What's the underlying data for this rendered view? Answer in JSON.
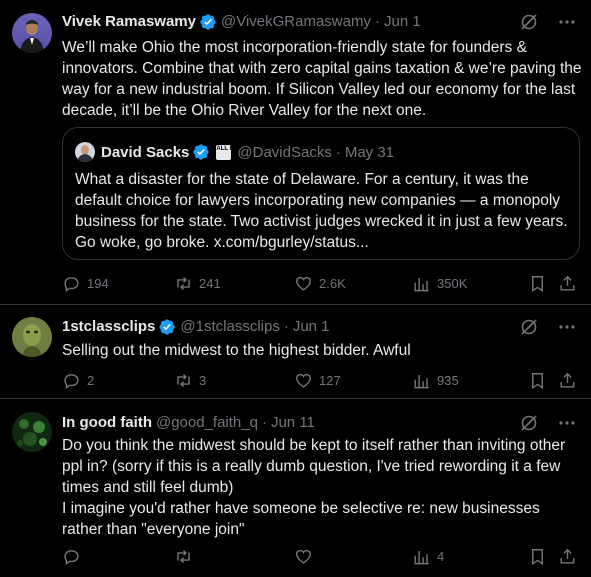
{
  "tweets": [
    {
      "name": "Vivek Ramaswamy",
      "handle": "@VivekGRamaswamy",
      "dot": "·",
      "date": "Jun 1",
      "text": "We’ll make Ohio the most incorporation-friendly state for founders & innovators. Combine that with zero capital gains taxation & we’re paving the way for a new industrial boom. If Silicon Valley led our economy for the last decade, it’ll be the Ohio River Valley for the next one.",
      "quote": {
        "name": "David Sacks",
        "badge": "ALL IN",
        "handle": "@DavidSacks",
        "dot": "·",
        "date": "May 31",
        "text": "What a disaster for the state of Delaware. For a century, it was the default choice for lawyers incorporating new companies — a monopoly business for the state. Two activist judges wrecked it in just a few years. Go woke, go broke. x.com/bgurley/status..."
      },
      "replies": "194",
      "reposts": "241",
      "likes": "2.6K",
      "views": "350K"
    },
    {
      "name": "1stclassclips",
      "handle": "@1stclassclips",
      "dot": "·",
      "date": "Jun 1",
      "text": "Selling out the midwest to the highest bidder. Awful",
      "replies": "2",
      "reposts": "3",
      "likes": "127",
      "views": "935"
    },
    {
      "name": "In good faith",
      "handle": "@good_faith_q",
      "dot": "·",
      "date": "Jun 11",
      "text_line1": "Do you think the midwest should be kept to itself rather than inviting other ppl in? (sorry if this is a really dumb question, I've tried rewording it a few times and still feel dumb)",
      "text_line2": "I imagine you'd rather have someone be selective re: new businesses rather than \"everyone join\"",
      "views": "4"
    }
  ],
  "colors": {
    "background": "#000000",
    "text": "#e7e9ea",
    "muted": "#71767b",
    "verified": "#1d9bf0",
    "divider": "#2f3336"
  },
  "icons": [
    "verified-badge-icon",
    "grok-icon",
    "more-icon",
    "reply-icon",
    "repost-icon",
    "like-icon",
    "views-icon",
    "bookmark-icon",
    "share-icon"
  ]
}
